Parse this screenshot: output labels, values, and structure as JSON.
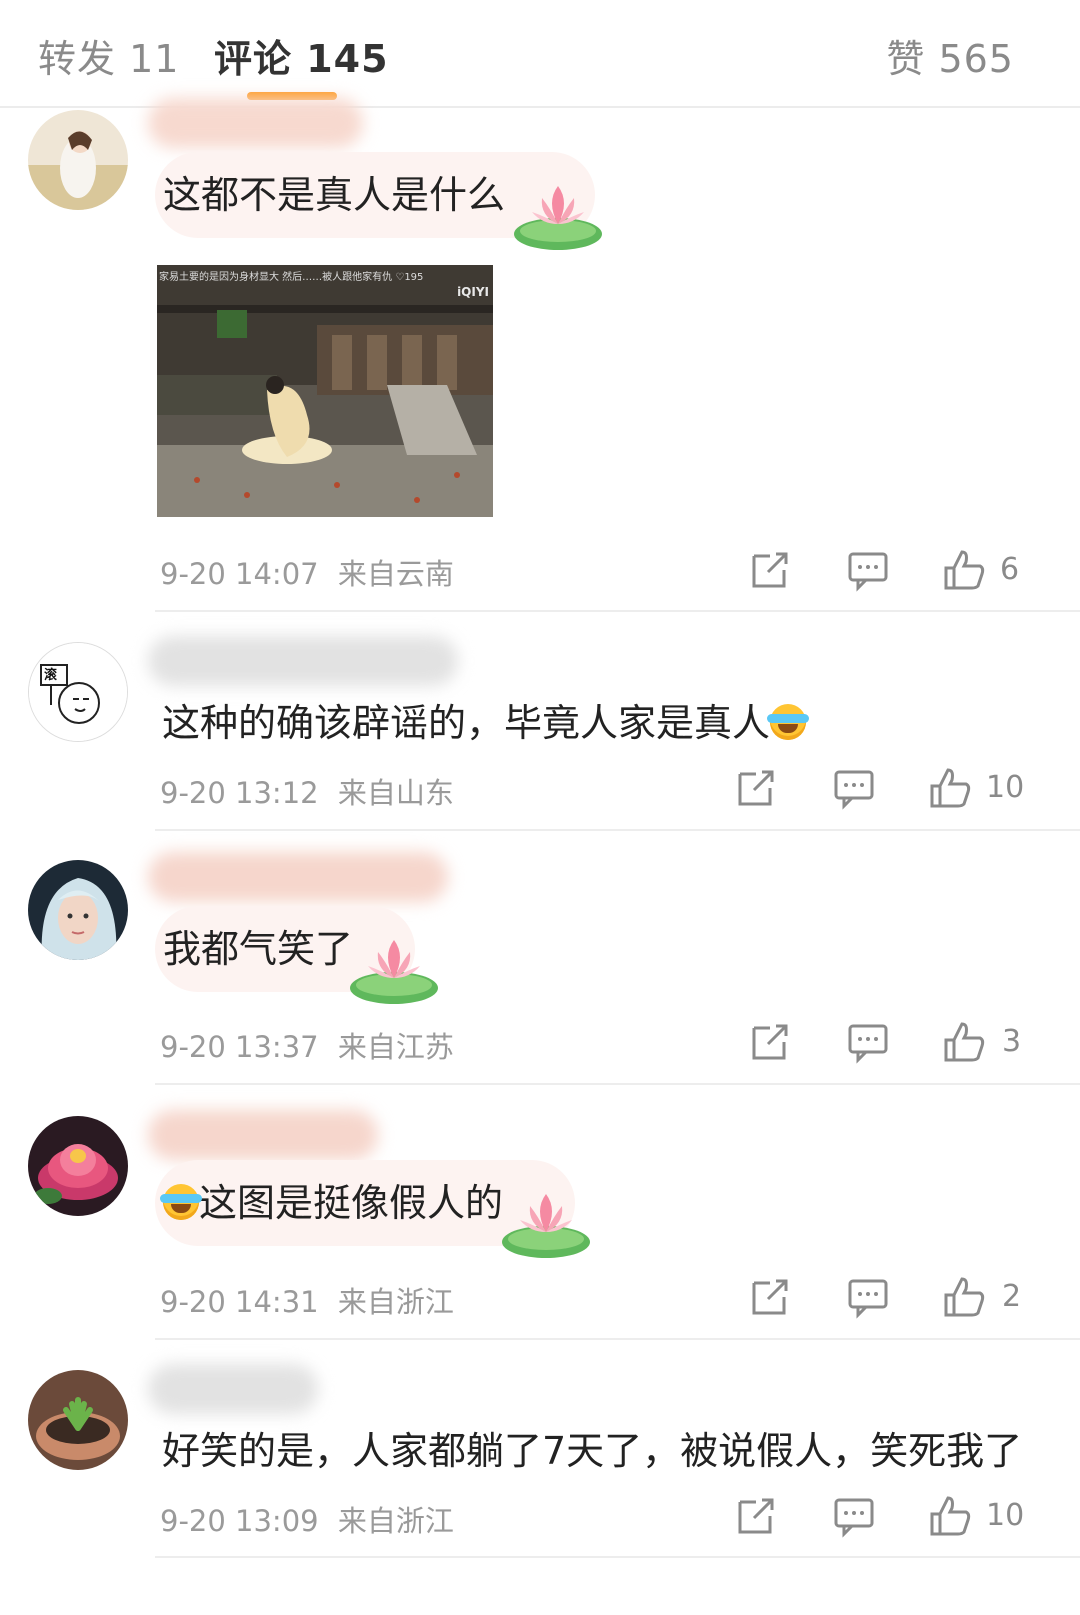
{
  "tabs": {
    "repost": "转发 11",
    "comment": "评论 145",
    "like": "赞 565"
  },
  "colors": {
    "accent": "#ff9a1f",
    "meta_gray": "#9a9a9a",
    "icon_gray": "#8a8a8a"
  },
  "comments": [
    {
      "text": "这都不是真人是什么",
      "time": "9-20 14:07",
      "location": "来自云南",
      "likes": "6",
      "has_image": true,
      "image": {
        "caption": "家易土要的是因为身材显大 然后……被人跟他家有仇 ♡195",
        "logo": "iQIYI"
      }
    },
    {
      "text": "这种的确该辟谣的，毕竟人家是真人",
      "emoji": "cry-laugh-icon",
      "time": "9-20 13:12",
      "location": "来自山东",
      "likes": "10",
      "avatar_text": "滚"
    },
    {
      "text": "我都气笑了",
      "time": "9-20 13:37",
      "location": "来自江苏",
      "likes": "3"
    },
    {
      "text": "这图是挺像假人的",
      "emoji": "cry-laugh-icon",
      "time": "9-20 14:31",
      "location": "来自浙江",
      "likes": "2"
    },
    {
      "text": "好笑的是，人家都躺了7天了，被说假人，笑死我了",
      "time": "9-20 13:09",
      "location": "来自浙江",
      "likes": "10"
    }
  ]
}
